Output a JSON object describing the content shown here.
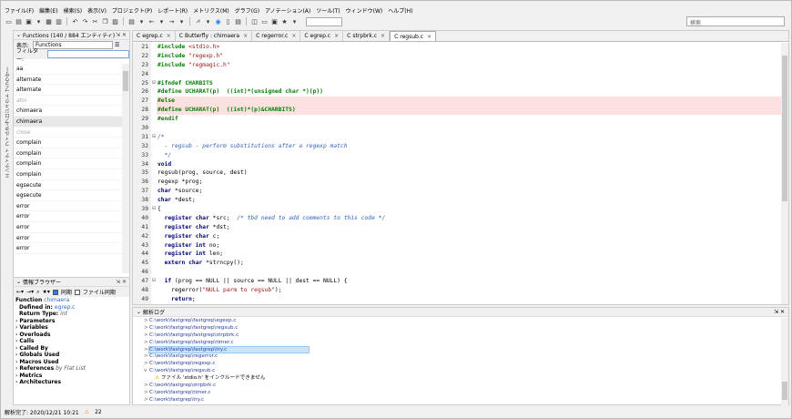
{
  "menubar": [
    "ファイル(F)",
    "編集(E)",
    "検索(S)",
    "表示(V)",
    "プロジェクト(P)",
    "レポート(R)",
    "メトリクス(M)",
    "グラフ(G)",
    "アノテーション(A)",
    "ツール(T)",
    "ウィンドウ(W)",
    "ヘルプ(H)"
  ],
  "toolbar": {
    "search_placeholder": "検索"
  },
  "sidebar_vertical_tabs": [
    "プロジェクト ブラウザー",
    "エンティティ フィルター"
  ],
  "functions_pane": {
    "title": "Functions (140 / 884 エンティティ)",
    "display_label": "表示:",
    "display_value": "Functions",
    "filter_label": "フィルター:",
    "filter_value": "",
    "items": [
      {
        "name": "aa",
        "state": "normal"
      },
      {
        "name": "alternate",
        "state": "normal"
      },
      {
        "name": "alternate",
        "state": "normal"
      },
      {
        "name": "atoi",
        "state": "dim"
      },
      {
        "name": "chimaera",
        "state": "normal"
      },
      {
        "name": "chimaera",
        "state": "selected"
      },
      {
        "name": "close",
        "state": "dim"
      },
      {
        "name": "complain",
        "state": "normal"
      },
      {
        "name": "complain",
        "state": "normal"
      },
      {
        "name": "complain",
        "state": "normal"
      },
      {
        "name": "complain",
        "state": "normal"
      },
      {
        "name": "egsecute",
        "state": "normal"
      },
      {
        "name": "egsecute",
        "state": "normal"
      },
      {
        "name": "error",
        "state": "normal"
      },
      {
        "name": "error",
        "state": "normal"
      },
      {
        "name": "error",
        "state": "normal"
      },
      {
        "name": "error",
        "state": "normal"
      },
      {
        "name": "error",
        "state": "normal"
      }
    ]
  },
  "info_pane": {
    "title": "情報ブラウザー",
    "sync_label": "同期",
    "file_sync_label": "ファイル同期",
    "function_label": "Function",
    "function_name": "chimaera",
    "defined_in_label": "Defined in:",
    "defined_in_value": "egrep.c",
    "return_type_label": "Return Type:",
    "return_type_value": "int",
    "sections": [
      "Parameters",
      "Variables",
      "Overloads",
      "Calls",
      "Called By",
      "Globals Used",
      "Macros Used",
      "References",
      "Metrics",
      "Architectures"
    ],
    "references_suffix": "by Flat List"
  },
  "editor": {
    "tabs": [
      {
        "label": "egrep.c",
        "active": false
      },
      {
        "label": "Butterfly : chimaera",
        "active": false
      },
      {
        "label": "regerror.c",
        "active": false
      },
      {
        "label": "egrep.c",
        "active": false
      },
      {
        "label": "strpbrk.c",
        "active": false
      },
      {
        "label": "regsub.c",
        "active": true
      }
    ],
    "lines": [
      {
        "n": "21",
        "fold": "",
        "err": false,
        "segs": [
          [
            "pp",
            "#include "
          ],
          [
            "st",
            "<stdio.h>"
          ]
        ]
      },
      {
        "n": "22",
        "fold": "",
        "err": false,
        "segs": [
          [
            "pp",
            "#include "
          ],
          [
            "st",
            "\"regexp.h\""
          ]
        ]
      },
      {
        "n": "23",
        "fold": "",
        "err": false,
        "segs": [
          [
            "pp",
            "#include "
          ],
          [
            "st",
            "\"regmagic.h\""
          ]
        ]
      },
      {
        "n": "24",
        "fold": "",
        "err": false,
        "segs": []
      },
      {
        "n": "25",
        "fold": "⊟",
        "err": false,
        "segs": [
          [
            "pp",
            "#ifndef CHARBITS"
          ]
        ]
      },
      {
        "n": "26",
        "fold": "",
        "err": false,
        "segs": [
          [
            "pp",
            "#define UCHARAT(p)  ((int)*(unsigned char *)(p))"
          ]
        ]
      },
      {
        "n": "27",
        "fold": "",
        "err": true,
        "segs": [
          [
            "pp",
            "#else"
          ]
        ]
      },
      {
        "n": "28",
        "fold": "",
        "err": true,
        "segs": [
          [
            "pp",
            "#define UCHARAT(p)  ((int)*(p)&CHARBITS)"
          ]
        ]
      },
      {
        "n": "29",
        "fold": "",
        "err": false,
        "segs": [
          [
            "pp",
            "#endif"
          ]
        ]
      },
      {
        "n": "30",
        "fold": "",
        "err": false,
        "segs": []
      },
      {
        "n": "31",
        "fold": "⊟",
        "err": false,
        "segs": [
          [
            "cm",
            "/*"
          ]
        ]
      },
      {
        "n": "32",
        "fold": "",
        "err": false,
        "segs": [
          [
            "cm",
            "  - regsub - perform substitutions after a regexp match"
          ]
        ]
      },
      {
        "n": "33",
        "fold": "",
        "err": false,
        "segs": [
          [
            "cm",
            "  */"
          ]
        ]
      },
      {
        "n": "34",
        "fold": "",
        "err": false,
        "segs": [
          [
            "kw",
            "void"
          ]
        ]
      },
      {
        "n": "35",
        "fold": "",
        "err": false,
        "segs": [
          [
            "id",
            "regsub(prog, source, dest)"
          ]
        ]
      },
      {
        "n": "36",
        "fold": "",
        "err": false,
        "segs": [
          [
            "id",
            "regexp *prog;"
          ]
        ]
      },
      {
        "n": "37",
        "fold": "",
        "err": false,
        "segs": [
          [
            "kw",
            "char"
          ],
          [
            "id",
            " *source;"
          ]
        ]
      },
      {
        "n": "38",
        "fold": "",
        "err": false,
        "segs": [
          [
            "kw",
            "char"
          ],
          [
            "id",
            " *dest;"
          ]
        ]
      },
      {
        "n": "39",
        "fold": "⊟",
        "err": false,
        "segs": [
          [
            "id",
            "{"
          ]
        ]
      },
      {
        "n": "40",
        "fold": "",
        "err": false,
        "segs": [
          [
            "kw",
            "  register char"
          ],
          [
            "id",
            " *src;  "
          ],
          [
            "cm",
            "/* tbd need to add comments to this code */"
          ]
        ]
      },
      {
        "n": "41",
        "fold": "",
        "err": false,
        "segs": [
          [
            "kw",
            "  register char"
          ],
          [
            "id",
            " *dst;"
          ]
        ]
      },
      {
        "n": "42",
        "fold": "",
        "err": false,
        "segs": [
          [
            "kw",
            "  register char"
          ],
          [
            "id",
            " c;"
          ]
        ]
      },
      {
        "n": "43",
        "fold": "",
        "err": false,
        "segs": [
          [
            "kw",
            "  register int"
          ],
          [
            "id",
            " no;"
          ]
        ]
      },
      {
        "n": "44",
        "fold": "",
        "err": false,
        "segs": [
          [
            "kw",
            "  register int"
          ],
          [
            "id",
            " len;"
          ]
        ]
      },
      {
        "n": "45",
        "fold": "",
        "err": false,
        "segs": [
          [
            "kw",
            "  extern char"
          ],
          [
            "id",
            " *strncpy();"
          ]
        ]
      },
      {
        "n": "46",
        "fold": "",
        "err": false,
        "segs": []
      },
      {
        "n": "47",
        "fold": "⊟",
        "err": false,
        "segs": [
          [
            "kw",
            "  if"
          ],
          [
            "id",
            " (prog == NULL || source == NULL || dest == NULL) {"
          ]
        ]
      },
      {
        "n": "48",
        "fold": "",
        "err": false,
        "segs": [
          [
            "id",
            "    regerror("
          ],
          [
            "st",
            "\"NULL parm to regsub\""
          ],
          [
            "id",
            ");"
          ]
        ]
      },
      {
        "n": "49",
        "fold": "",
        "err": false,
        "segs": [
          [
            "kw",
            "    return"
          ],
          [
            "id",
            ";"
          ]
        ]
      }
    ]
  },
  "log_pane": {
    "title": "解析ログ",
    "entries": [
      {
        "text": "C:\\work\\fastgrep\\fastgrep\\egexp.c",
        "type": "path",
        "chevron": ">"
      },
      {
        "text": "C:\\work\\fastgrep\\fastgrep\\regsub.c",
        "type": "path",
        "chevron": ">"
      },
      {
        "text": "C:\\work\\fastgrep\\fastgrep\\strpbrk.c",
        "type": "path",
        "chevron": ">"
      },
      {
        "text": "C:\\work\\fastgrep\\fastgrep\\timer.c",
        "type": "path",
        "chevron": ">"
      },
      {
        "text": "C:\\work\\fastgrep\\fastgrep\\try.c",
        "type": "path",
        "chevron": ">",
        "highlight": true
      },
      {
        "text": "C:\\work\\fastgrep\\regerror.c",
        "type": "path",
        "chevron": ">"
      },
      {
        "text": "C:\\work\\fastgrep\\regexp.c",
        "type": "path",
        "chevron": ">"
      },
      {
        "text": "C:\\work\\fastgrep\\regsub.c",
        "type": "path",
        "chevron": "v"
      },
      {
        "text": "ファイル 'stdio.h' をインクルードできません",
        "type": "warning",
        "chevron": ""
      },
      {
        "text": "C:\\work\\fastgrep\\strpbrk.c",
        "type": "path",
        "chevron": ">"
      },
      {
        "text": "C:\\work\\fastgrep\\timer.c",
        "type": "path",
        "chevron": ">"
      },
      {
        "text": "C:\\work\\fastgrep\\try.c",
        "type": "path",
        "chevron": ">"
      }
    ]
  },
  "statusbar": {
    "text": "解析完了: 2020/12/21 10:21",
    "warnings": "22"
  }
}
